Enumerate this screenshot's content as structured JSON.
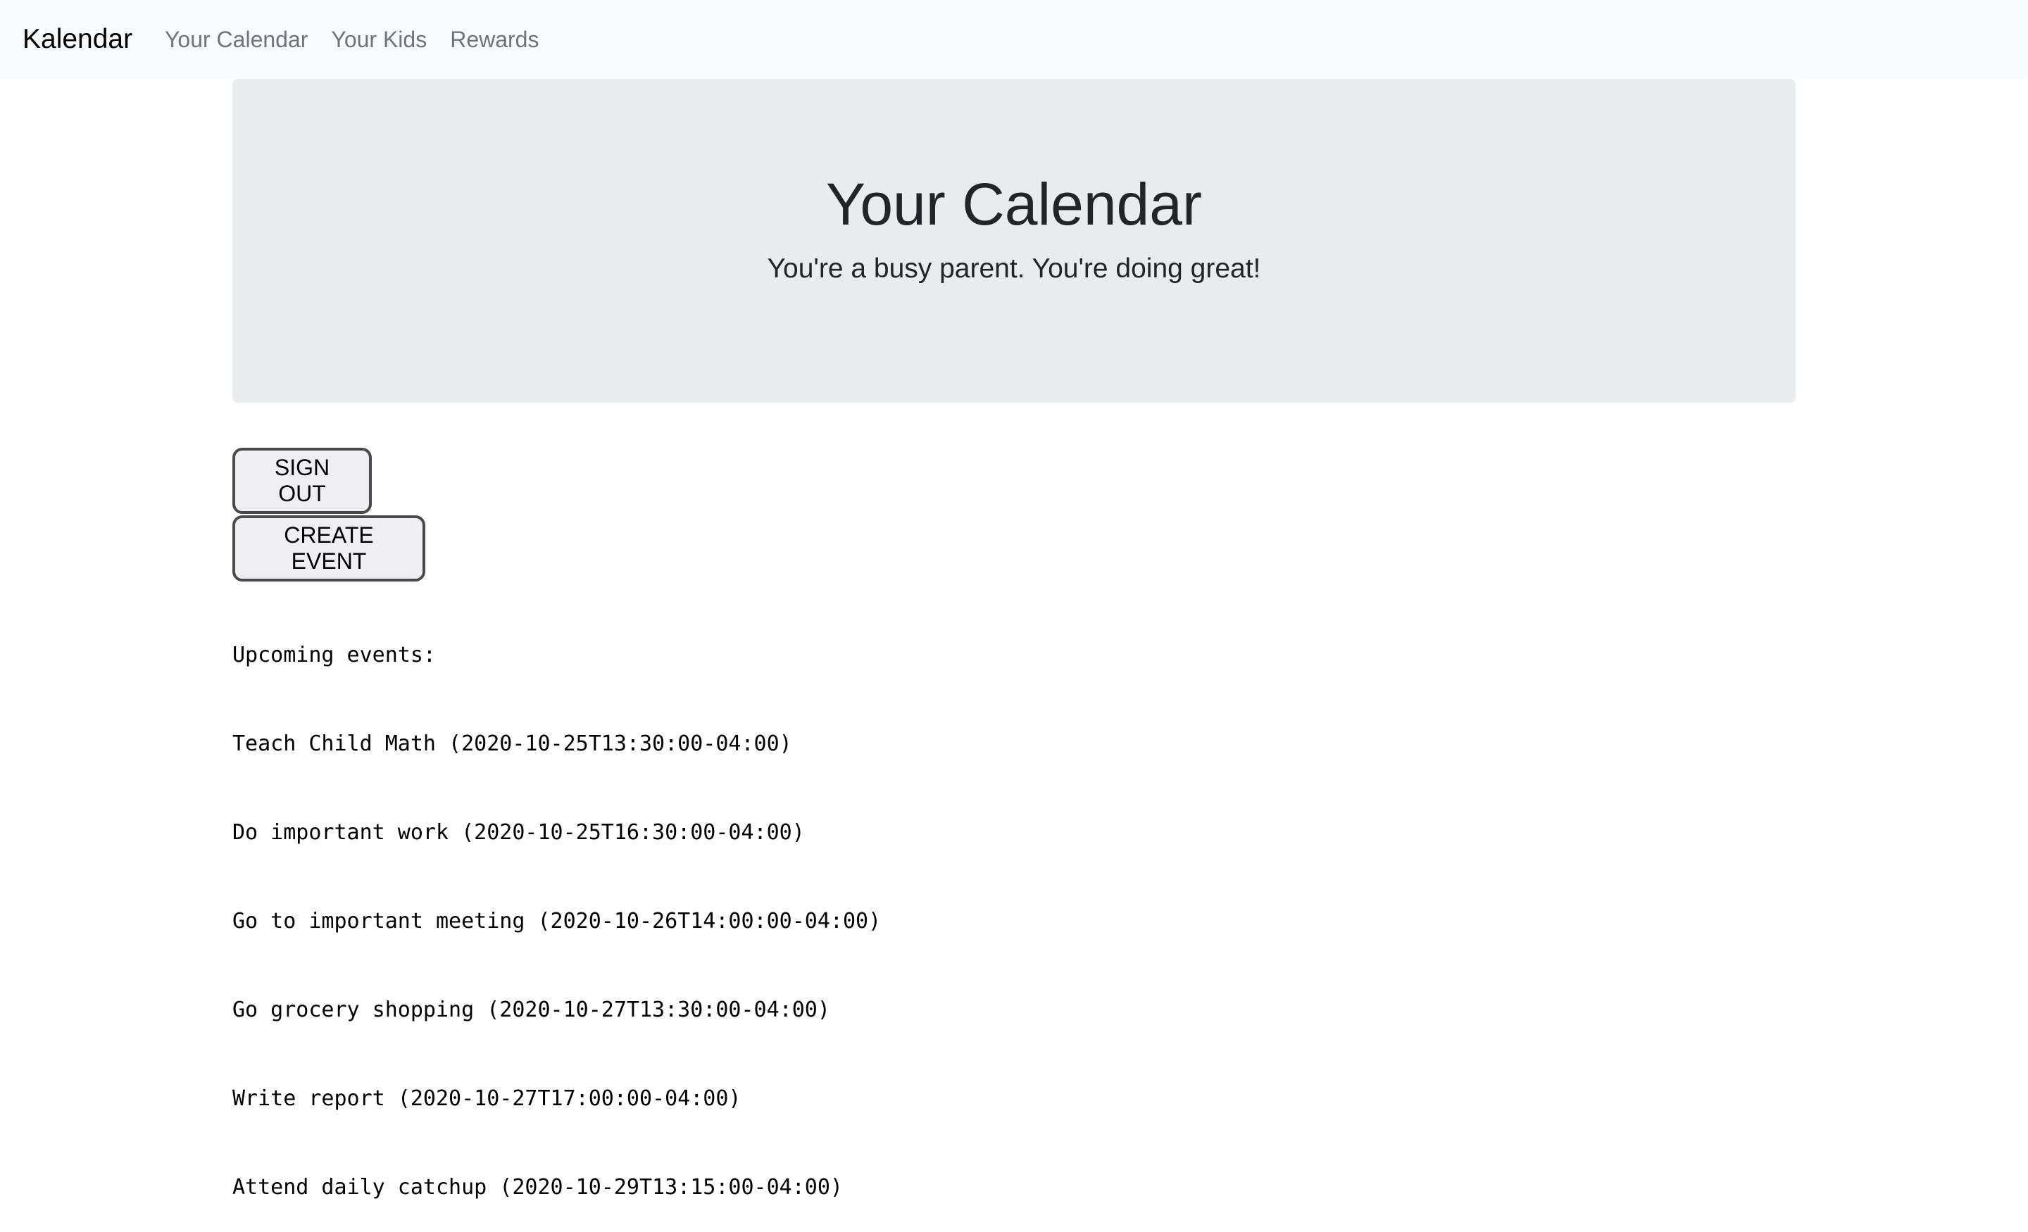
{
  "navbar": {
    "brand": "Kalendar",
    "links": [
      {
        "label": "Your Calendar"
      },
      {
        "label": "Your Kids"
      },
      {
        "label": "Rewards"
      }
    ]
  },
  "hero": {
    "title": "Your Calendar",
    "subtitle": "You're a busy parent. You're doing great!"
  },
  "buttons": {
    "sign_out": "SIGN OUT",
    "create_event": "CREATE EVENT"
  },
  "events": {
    "heading": "Upcoming events:",
    "items": [
      {
        "text": "Teach Child Math (2020-10-25T13:30:00-04:00)"
      },
      {
        "text": "Do important work (2020-10-25T16:30:00-04:00)"
      },
      {
        "text": "Go to important meeting (2020-10-26T14:00:00-04:00)"
      },
      {
        "text": "Go grocery shopping (2020-10-27T13:30:00-04:00)"
      },
      {
        "text": "Write report (2020-10-27T17:00:00-04:00)"
      },
      {
        "text": "Attend daily catchup (2020-10-29T13:15:00-04:00)"
      }
    ]
  },
  "colors": {
    "navbar_bg": "#f8f9fa",
    "jumbotron_bg": "#e9ecef",
    "nav_link": "#6c757d",
    "text": "#212529"
  }
}
